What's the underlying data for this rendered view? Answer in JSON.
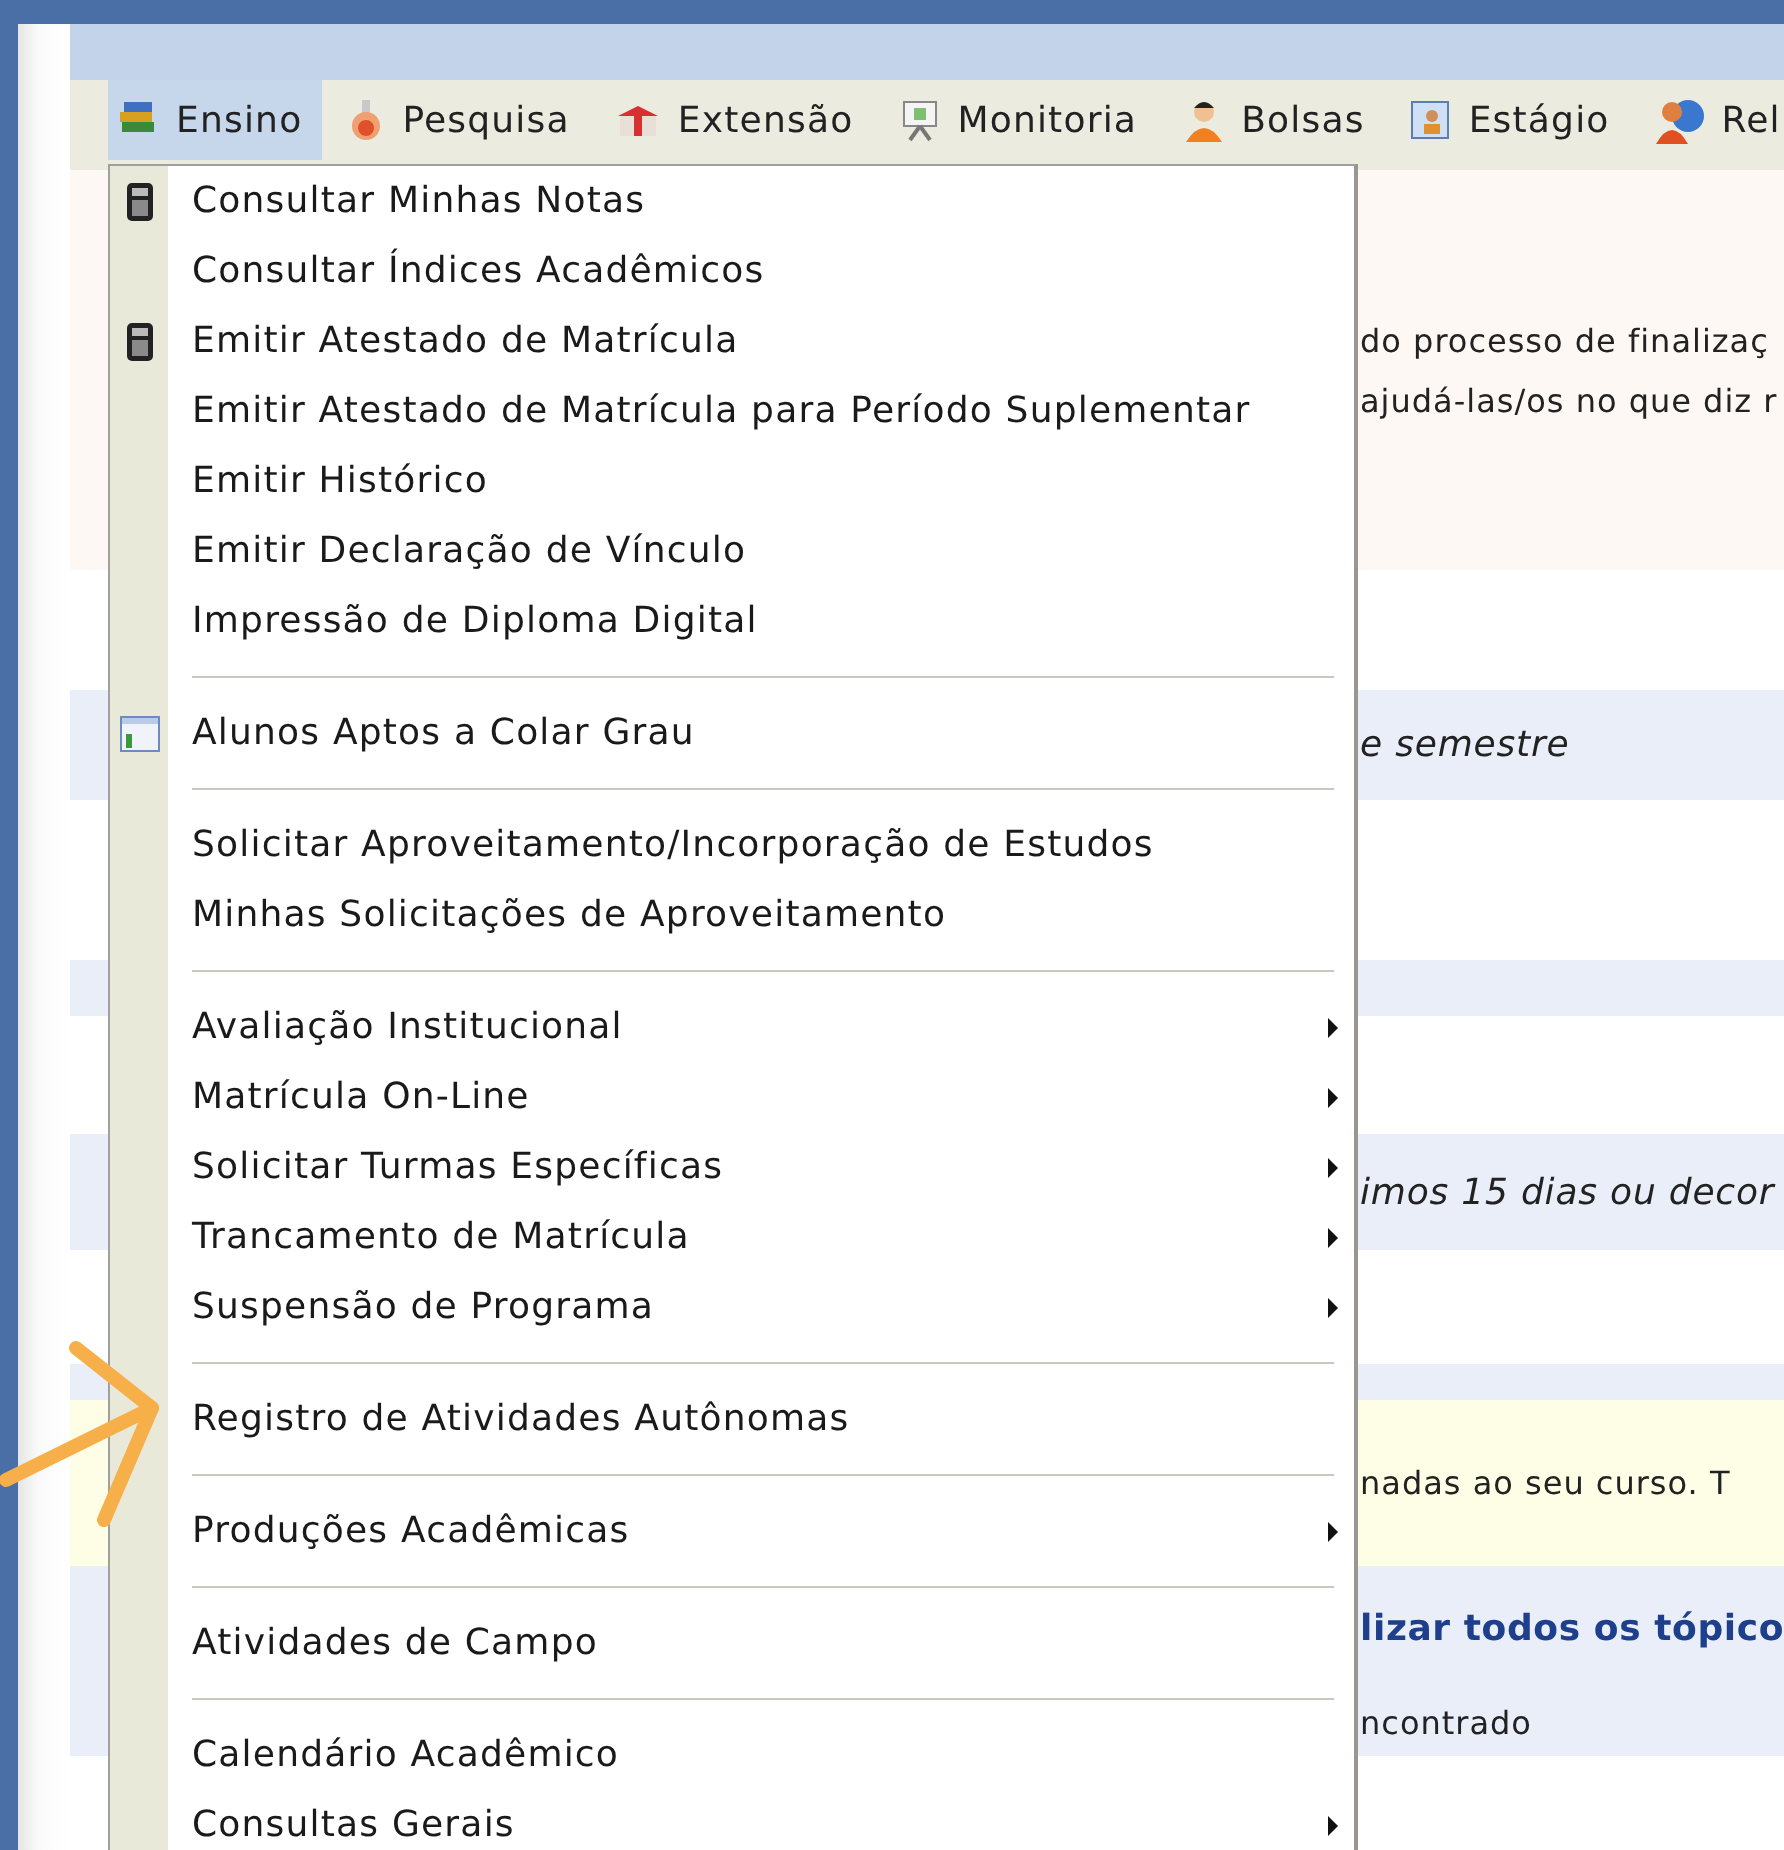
{
  "menu_bar": [
    {
      "label": "Ensino",
      "kind": "books",
      "selected": true
    },
    {
      "label": "Pesquisa",
      "kind": "flask",
      "selected": false
    },
    {
      "label": "Extensão",
      "kind": "gift",
      "selected": false
    },
    {
      "label": "Monitoria",
      "kind": "easel",
      "selected": false
    },
    {
      "label": "Bolsas",
      "kind": "person",
      "selected": false
    },
    {
      "label": "Estágio",
      "kind": "badge",
      "selected": false
    },
    {
      "label": "Rel",
      "kind": "globe",
      "selected": false
    }
  ],
  "dropdown": {
    "groups": [
      [
        {
          "label": "Consultar Minhas Notas",
          "kind": "calculator",
          "submenu": false
        },
        {
          "label": "Consultar Índices Acadêmicos",
          "submenu": false
        },
        {
          "label": "Emitir Atestado de Matrícula",
          "kind": "calculator",
          "submenu": false
        },
        {
          "label": "Emitir Atestado de Matrícula para Período Suplementar",
          "submenu": false
        },
        {
          "label": "Emitir Histórico",
          "submenu": false
        },
        {
          "label": "Emitir Declaração de Vínculo",
          "submenu": false
        },
        {
          "label": "Impressão de Diploma Digital",
          "submenu": false
        }
      ],
      [
        {
          "label": "Alunos Aptos a Colar Grau",
          "kind": "window",
          "submenu": false
        }
      ],
      [
        {
          "label": "Solicitar Aproveitamento/Incorporação de Estudos",
          "submenu": false
        },
        {
          "label": "Minhas Solicitações de Aproveitamento",
          "submenu": false
        }
      ],
      [
        {
          "label": "Avaliação Institucional",
          "submenu": true
        },
        {
          "label": "Matrícula On-Line",
          "submenu": true
        },
        {
          "label": "Solicitar Turmas Específicas",
          "submenu": true
        },
        {
          "label": "Trancamento de Matrícula",
          "submenu": true
        },
        {
          "label": "Suspensão de Programa",
          "submenu": true
        }
      ],
      [
        {
          "label": "Registro de Atividades Autônomas",
          "submenu": false
        }
      ],
      [
        {
          "label": "Produções Acadêmicas",
          "submenu": true
        }
      ],
      [
        {
          "label": "Atividades de Campo",
          "submenu": false
        }
      ],
      [
        {
          "label": "Calendário Acadêmico",
          "submenu": false
        },
        {
          "label": "Consultas Gerais",
          "submenu": true
        }
      ]
    ]
  },
  "content_rows": [
    {
      "color": "#fdf8f3",
      "lines": [
        "do processo de finalizaç",
        "ajudá-las/os no que diz r"
      ]
    },
    {
      "color": "#e9eef8",
      "lines": [
        "e semestre"
      ],
      "kind": "italic"
    },
    {
      "color": "#e9eef8"
    },
    {
      "color": "#e9eef8",
      "lines": [
        "imos 15 dias ou decor"
      ],
      "kind": "italic"
    },
    {
      "color": "#e9eef8"
    },
    {
      "color": "#fefee6",
      "lines": [
        "nadas ao seu curso. T"
      ]
    },
    {
      "color": "#e9eef8",
      "lines": [
        "lizar todos os tópico"
      ],
      "kind": "link"
    },
    {
      "color": "#e9eef8",
      "lines": [
        "ncontrado"
      ]
    }
  ],
  "annotation": {
    "kind": "arrow"
  }
}
